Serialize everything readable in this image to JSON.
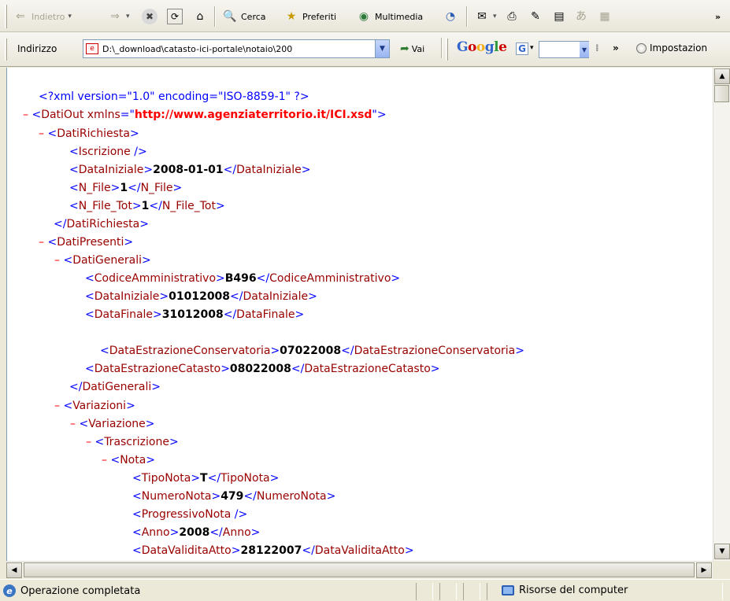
{
  "toolbar": {
    "back_label": "Indietro",
    "search_label": "Cerca",
    "favorites_label": "Preferiti",
    "media_label": "Multimedia"
  },
  "address": {
    "label": "Indirizzo",
    "value": "D:\\_download\\catasto-ici-portale\\notaio\\200",
    "go_label": "Vai"
  },
  "google": {
    "logo": "Google",
    "settings_label": "Impostazion"
  },
  "xml": {
    "decl": "<?xml version=\"1.0\" encoding=\"ISO-8859-1\" ?>",
    "root_open": "DatiOut",
    "root_attr": "xmlns",
    "root_ns": "http://www.agenziaterritorio.it/ICI.xsd",
    "dati_richiesta": "DatiRichiesta",
    "iscrizione": "Iscrizione",
    "data_iniziale": "DataIniziale",
    "data_iniziale_value": "2008-01-01",
    "n_file": "N_File",
    "n_file_value": "1",
    "n_file_tot": "N_File_Tot",
    "n_file_tot_value": "1",
    "dati_presenti": "DatiPresenti",
    "dati_generali": "DatiGenerali",
    "codice_amm": "CodiceAmministrativo",
    "codice_amm_value": "B496",
    "data_iniziale2_value": "01012008",
    "data_finale": "DataFinale",
    "data_finale_value": "31012008",
    "data_estr_cons": "DataEstrazioneConservatoria",
    "data_estr_cons_value": "07022008",
    "data_estr_cat": "DataEstrazioneCatasto",
    "data_estr_cat_value": "08022008",
    "variazioni": "Variazioni",
    "variazione": "Variazione",
    "trascrizione": "Trascrizione",
    "nota": "Nota",
    "tipo_nota": "TipoNota",
    "tipo_nota_value": "T",
    "numero_nota": "NumeroNota",
    "numero_nota_value": "479",
    "progressivo_nota": "ProgressivoNota",
    "anno": "Anno",
    "anno_value": "2008",
    "data_validita": "DataValiditaAtto",
    "data_validita_value": "28122007"
  },
  "status": {
    "text": "Operazione completata",
    "zone": "Risorse del computer"
  }
}
